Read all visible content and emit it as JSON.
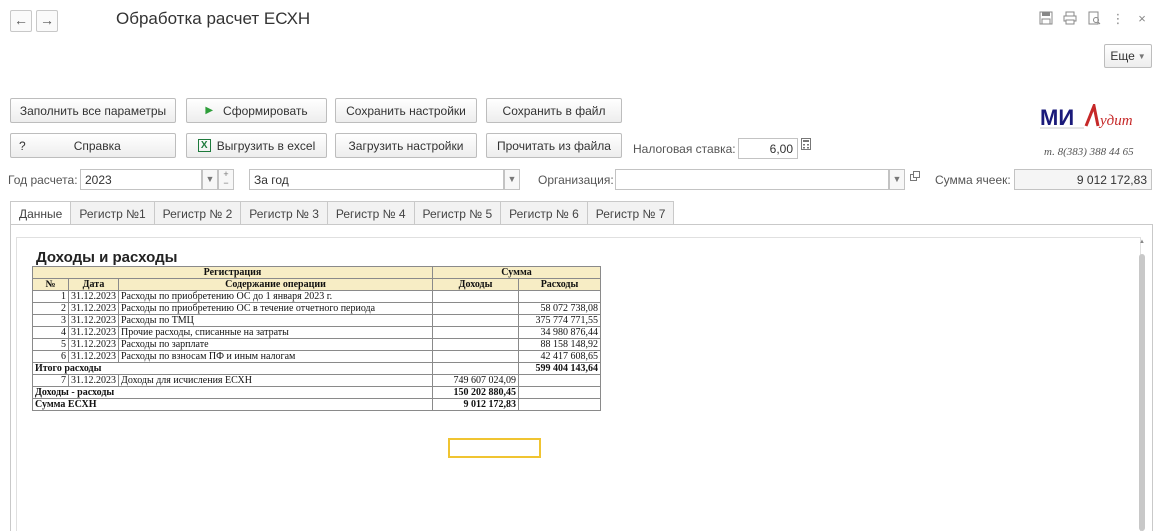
{
  "window": {
    "title": "Обработка расчет ЕСХН",
    "more_label": "Еще"
  },
  "toolbar": {
    "fill_all": "Заполнить все параметры",
    "generate": "Сформировать",
    "save_settings": "Сохранить настройки",
    "save_file": "Сохранить в файл",
    "help_glyph": "?",
    "help": "Справка",
    "export_excel": "Выгрузить в excel",
    "load_settings": "Загрузить настройки",
    "read_file": "Прочитать из файла",
    "tax_rate_label": "Налоговая ставка:",
    "tax_rate_value": "6,00"
  },
  "company": {
    "logo_text": "МИАудит",
    "phone": "т. 8(383) 388 44 65"
  },
  "params": {
    "year_label": "Год расчета:",
    "year_value": "2023",
    "period_value": "За год",
    "org_label": "Организация:",
    "org_value": "",
    "sum_label": "Сумма ячеек:",
    "sum_value": "9 012 172,83"
  },
  "tabs": [
    "Данные",
    "Регистр №1",
    "Регистр № 2",
    "Регистр № 3",
    "Регистр № 4",
    "Регистр № 5",
    "Регистр № 6",
    "Регистр № 7"
  ],
  "active_tab": "Данные",
  "report": {
    "title": "Доходы и расходы",
    "header_registration": "Регистрация",
    "header_sum": "Сумма",
    "col_no": "№",
    "col_date": "Дата",
    "col_content": "Содержание операции",
    "col_income": "Доходы",
    "col_expense": "Расходы",
    "rows": [
      {
        "no": "1",
        "date": "31.12.2023",
        "content": "Расходы по приобретению ОС до 1 января 2023 г.",
        "income": "",
        "expense": ""
      },
      {
        "no": "2",
        "date": "31.12.2023",
        "content": "Расходы по приобретению ОС в течение отчетного периода",
        "income": "",
        "expense": "58 072 738,08"
      },
      {
        "no": "3",
        "date": "31.12.2023",
        "content": "Расходы по ТМЦ",
        "income": "",
        "expense": "375 774 771,55"
      },
      {
        "no": "4",
        "date": "31.12.2023",
        "content": "Прочие расходы, списанные на затраты",
        "income": "",
        "expense": "34 980 876,44"
      },
      {
        "no": "5",
        "date": "31.12.2023",
        "content": "Расходы по зарплате",
        "income": "",
        "expense": "88 158 148,92"
      },
      {
        "no": "6",
        "date": "31.12.2023",
        "content": "Расходы по взносам ПФ и иным налогам",
        "income": "",
        "expense": "42 417 608,65"
      }
    ],
    "total_expenses_label": "Итого расходы",
    "total_expenses_value": "599 404 143,64",
    "income_row": {
      "no": "7",
      "date": "31.12.2023",
      "content": "Доходы для исчисления ЕСХН",
      "income": "749 607 024,09"
    },
    "diff_label": "Доходы - расходы",
    "diff_value": "150 202 880,45",
    "tax_label": "Сумма ЕСХН",
    "tax_value": "9 012 172,83"
  },
  "colors": {
    "header_fill": "#f7edc5",
    "highlight": "#f0c431",
    "logo_blue": "#1a1a7a",
    "logo_red": "#c62828",
    "excel_green": "#1e7a3c",
    "play_green": "#2e9e3a"
  }
}
